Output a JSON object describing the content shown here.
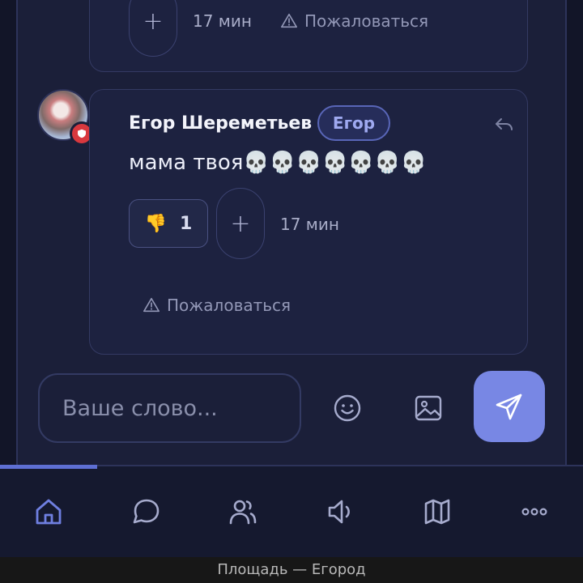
{
  "previous_message": {
    "add_reaction_label": "+",
    "time": "17 мин",
    "report_label": "Пожаловаться"
  },
  "message": {
    "author": "Егор Шереметьев",
    "author_tag": "Егор",
    "text": "мама твоя💀💀💀💀💀💀💀",
    "reaction": {
      "emoji": "👎",
      "count": "1"
    },
    "add_reaction_label": "+",
    "time": "17 мин",
    "report_label": "Пожаловаться"
  },
  "composer": {
    "placeholder": "Ваше слово..."
  },
  "nav": {
    "items": [
      "home-icon",
      "chat-icon",
      "users-icon",
      "announcement-icon",
      "map-icon",
      "more-icon"
    ],
    "active": "home-icon",
    "progress_fraction": 0.167
  },
  "window_caption": "Площадь — Егород",
  "colors": {
    "accent": "#7887e4",
    "badge": "#d9383e",
    "background": "#1b1f39"
  }
}
